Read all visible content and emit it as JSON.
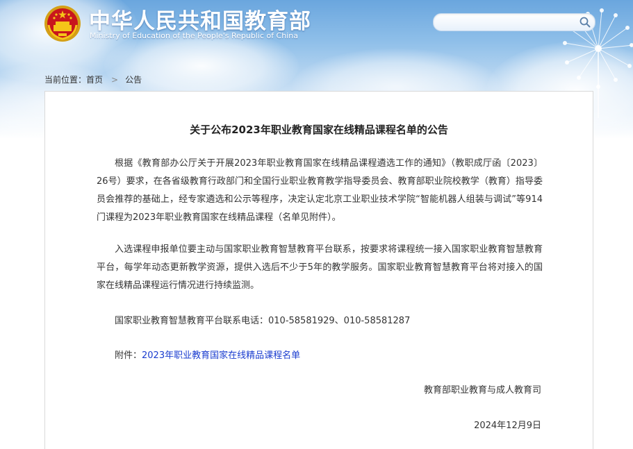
{
  "header": {
    "site_title": "中华人民共和国教育部",
    "site_subtitle": "Ministry of Education of the People's Republic of China",
    "emblem_icon": "national-emblem-icon",
    "search": {
      "value": "",
      "placeholder": "",
      "button_icon": "search-icon"
    }
  },
  "breadcrumb": {
    "prefix": "当前位置：",
    "items": [
      "首页",
      "公告"
    ],
    "separator_icon": "chevron-right-icon"
  },
  "article": {
    "title": "关于公布2023年职业教育国家在线精品课程名单的公告",
    "paragraphs": [
      "根据《教育部办公厅关于开展2023年职业教育国家在线精品课程遴选工作的通知》（教职成厅函〔2023〕26号）要求，在各省级教育行政部门和全国行业职业教育教学指导委员会、教育部职业院校教学（教育）指导委员会推荐的基础上，经专家遴选和公示等程序，决定认定北京工业职业技术学院“智能机器人组装与调试”等914门课程为2023年职业教育国家在线精品课程（名单见附件）。",
      "入选课程申报单位要主动与国家职业教育智慧教育平台联系，按要求将课程统一接入国家职业教育智慧教育平台，每学年动态更新教学资源，提供入选后不少于5年的教学服务。国家职业教育智慧教育平台将对接入的国家在线精品课程运行情况进行持续监测。"
    ],
    "contact": "国家职业教育智慧教育平台联系电话：010-58581929、010-58581287",
    "attachment_prefix": "附件：",
    "attachment_link": "2023年职业教育国家在线精品课程名单",
    "issuer": "教育部职业教育与成人教育司",
    "date": "2024年12月9日"
  },
  "colors": {
    "sky_top": "#6aa6de",
    "link": "#1a3ccf",
    "text": "#333333",
    "title": "#222222",
    "border": "#d9d9d9"
  }
}
